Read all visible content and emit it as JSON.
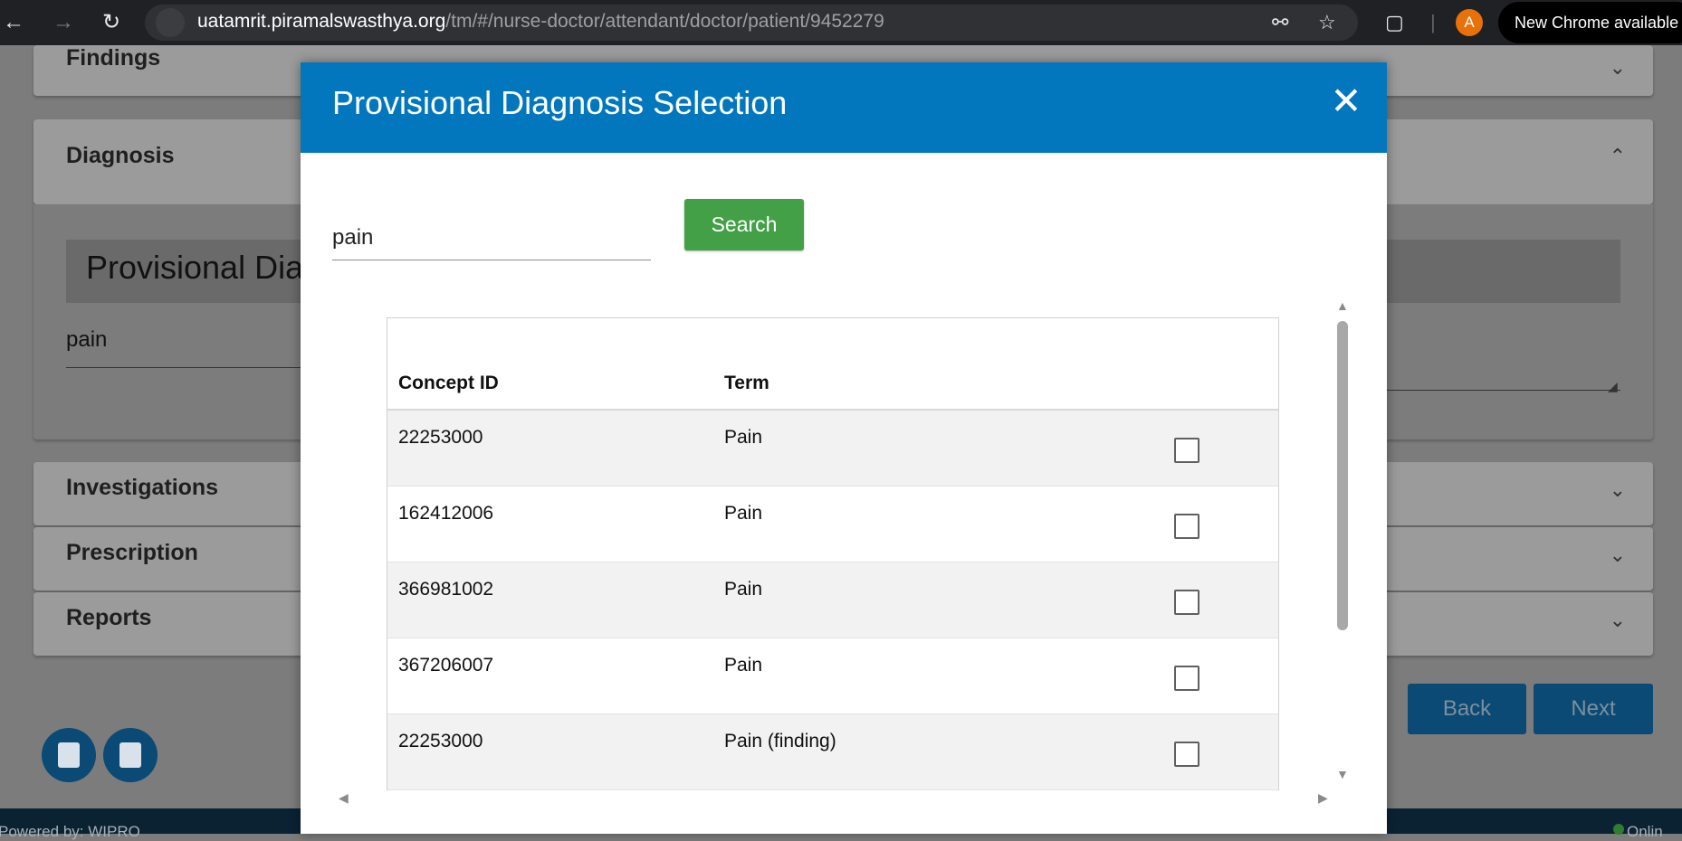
{
  "browser": {
    "url_host": "uatamrit.piramalswasthya.org",
    "url_path": "/tm/#/nurse-doctor/attendant/doctor/patient/9452279",
    "profile_initial": "A",
    "update_label": "New Chrome available"
  },
  "background": {
    "sections": {
      "findings": "Findings",
      "diagnosis": "Diagnosis",
      "investigations": "Investigations",
      "prescription": "Prescription",
      "reports": "Reports"
    },
    "provisional_heading": "Provisional Dia",
    "provisional_value": "pain",
    "back_label": "Back",
    "next_label": "Next",
    "footer_left": "Powered by: WIPRO",
    "footer_right": "Onlin"
  },
  "modal": {
    "title": "Provisional Diagnosis Selection",
    "close_symbol": "✕",
    "search_value": "pain",
    "search_label": "Search",
    "columns": {
      "concept_id": "Concept ID",
      "term": "Term"
    },
    "rows": [
      {
        "concept_id": "22253000",
        "term": "Pain",
        "checked": false
      },
      {
        "concept_id": "162412006",
        "term": "Pain",
        "checked": false
      },
      {
        "concept_id": "366981002",
        "term": "Pain",
        "checked": false
      },
      {
        "concept_id": "367206007",
        "term": "Pain",
        "checked": false
      },
      {
        "concept_id": "22253000",
        "term": "Pain (finding)",
        "checked": false
      }
    ]
  },
  "colors": {
    "modal_header": "#0277bd",
    "search_button": "#43a047",
    "overlay_dim": "#7c7c7c"
  },
  "icons": [
    "back-arrow-icon",
    "forward-arrow-icon",
    "reload-icon",
    "site-info-icon",
    "key-icon",
    "star-icon",
    "extensions-icon",
    "close-icon",
    "chevron-down-icon",
    "chevron-up-icon",
    "person-card-icon",
    "document-icon"
  ]
}
